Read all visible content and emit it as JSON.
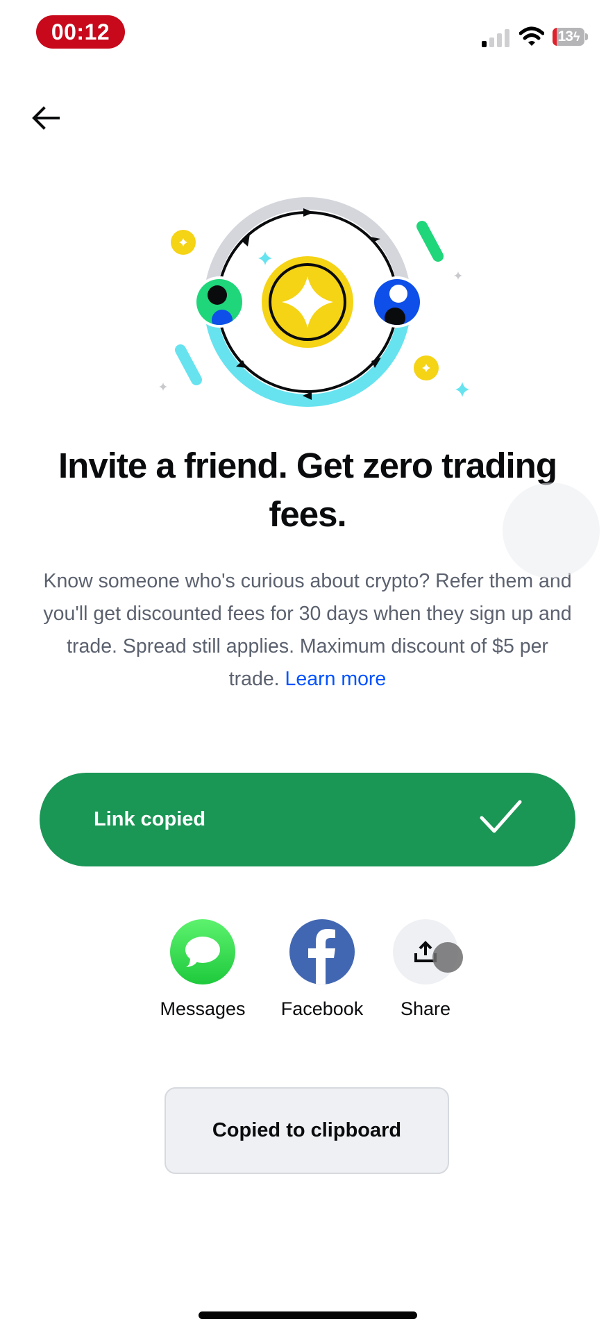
{
  "status_bar": {
    "timer": "00:12",
    "battery_percent": 13,
    "battery_text": "13",
    "battery_charging": true,
    "signal_bars_active": 1,
    "signal_bars_total": 4
  },
  "navigation": {
    "back_icon": "arrow-left-icon"
  },
  "illustration": {
    "description": "Two users exchanging a coin in a circular referral loop",
    "colors": {
      "coin": "#f5d315",
      "green_avatar": "#1fd67a",
      "blue_avatar": "#0d4fe8",
      "top_arc": "#d4d6dc",
      "bottom_arc": "#66e3ef"
    }
  },
  "content": {
    "heading": "Invite a friend. Get zero trading fees.",
    "body": "Know someone who's curious about crypto? Refer them and you'll get discounted fees for 30 days when they sign up and trade. Spread still applies. Maximum discount of $5 per trade.",
    "learn_more": "Learn more"
  },
  "copy_button": {
    "label": "Link copied",
    "icon": "checkmark-icon",
    "color": "#1a9655"
  },
  "share_options": [
    {
      "label": "Messages",
      "icon": "messages-icon",
      "color": "#2fd552"
    },
    {
      "label": "Facebook",
      "icon": "facebook-icon",
      "color": "#4267b2"
    },
    {
      "label": "Share",
      "icon": "share-icon",
      "color": "#eef0f3"
    }
  ],
  "toast": {
    "message": "Copied to clipboard"
  }
}
